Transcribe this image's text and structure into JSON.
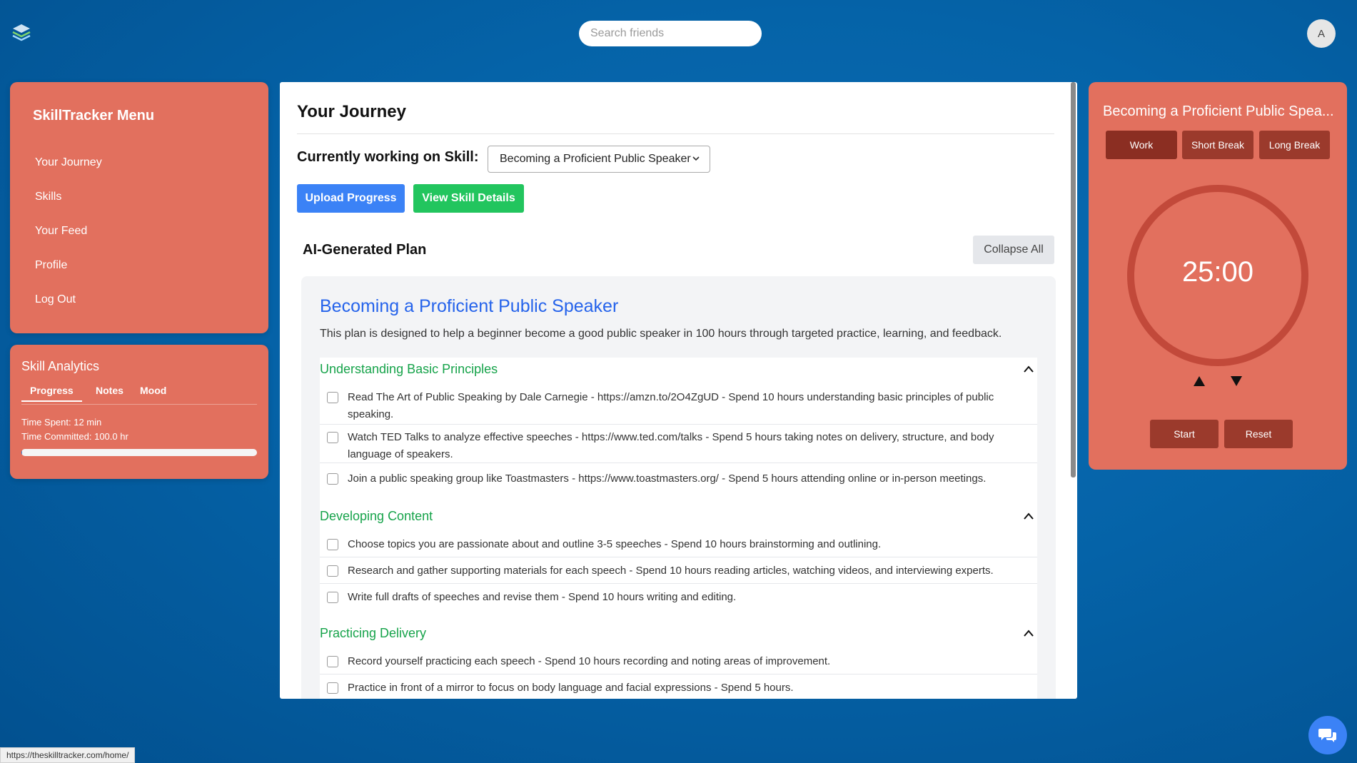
{
  "header": {
    "search_placeholder": "Search friends",
    "avatar_initial": "A"
  },
  "menu": {
    "title": "SkillTracker Menu",
    "items": [
      "Your Journey",
      "Skills",
      "Your Feed",
      "Profile",
      "Log Out"
    ]
  },
  "analytics": {
    "title": "Skill Analytics",
    "tabs": [
      "Progress",
      "Notes",
      "Mood"
    ],
    "time_spent": "Time Spent: 12 min",
    "time_committed": "Time Committed: 100.0 hr",
    "progress_fraction": 0.002
  },
  "journey": {
    "title": "Your Journey",
    "skill_label": "Currently working on Skill:",
    "selected_skill": "Becoming a Proficient Public Speaker",
    "upload_label": "Upload Progress",
    "details_label": "View Skill Details",
    "plan_heading": "AI-Generated Plan",
    "collapse_label": "Collapse All"
  },
  "plan": {
    "title": "Becoming a Proficient Public Speaker",
    "description": "This plan is designed to help a beginner become a good public speaker in 100 hours through targeted practice, learning, and feedback.",
    "sections": [
      {
        "title": "Understanding Basic Principles",
        "tasks": [
          "Read The Art of Public Speaking by Dale Carnegie - https://amzn.to/2O4ZgUD - Spend 10 hours understanding basic principles of public speaking.",
          "Watch TED Talks to analyze effective speeches - https://www.ted.com/talks - Spend 5 hours taking notes on delivery, structure, and body language of speakers.",
          "Join a public speaking group like Toastmasters - https://www.toastmasters.org/ - Spend 5 hours attending online or in-person meetings."
        ]
      },
      {
        "title": "Developing Content",
        "tasks": [
          "Choose topics you are passionate about and outline 3-5 speeches - Spend 10 hours brainstorming and outlining.",
          "Research and gather supporting materials for each speech - Spend 10 hours reading articles, watching videos, and interviewing experts.",
          "Write full drafts of speeches and revise them - Spend 10 hours writing and editing."
        ]
      },
      {
        "title": "Practicing Delivery",
        "tasks": [
          "Record yourself practicing each speech - Spend 10 hours recording and noting areas of improvement.",
          "Practice in front of a mirror to focus on body language and facial expressions - Spend 5 hours."
        ]
      }
    ]
  },
  "timer": {
    "title": "Becoming a Proficient Public Spea...",
    "modes": [
      "Work",
      "Short Break",
      "Long Break"
    ],
    "time": "25:00",
    "start_label": "Start",
    "reset_label": "Reset"
  },
  "status_url": "https://theskilltracker.com/home/"
}
